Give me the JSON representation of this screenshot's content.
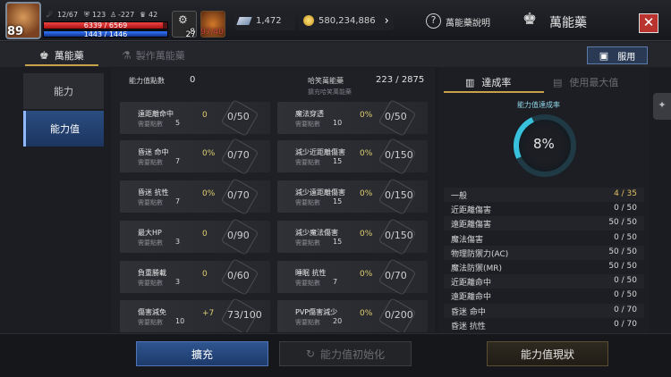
{
  "player": {
    "level": "89",
    "stat_a": "12/67",
    "stat_b": "123",
    "stat_c": "-227",
    "stat_d": "42",
    "hp_text": "6339 / 6569",
    "hp_fraction": 0.965,
    "mp_text": "1443 / 1446",
    "mp_fraction": 0.998,
    "buff1_count": "8",
    "buff2_count": "27",
    "buff3_count": "97/40"
  },
  "currency": {
    "gems": "1,472",
    "gold": "580,234,886"
  },
  "header": {
    "help_label": "萬能藥說明",
    "title": "萬能藥",
    "close_label": "✕"
  },
  "tabs": {
    "tab1": "萬能藥",
    "tab2": "製作萬能藥",
    "use_button": "服用"
  },
  "leftnav": {
    "item1": "能力",
    "item2": "能力值"
  },
  "center": {
    "points_label": "能力值點數",
    "points_value": "0",
    "grade_label": "哈笑萬能藥",
    "grade_value": "223 / 2875",
    "grade_sub": "擴充哈笑萬能藥",
    "required_label": "需要點數",
    "left_cells": [
      {
        "name": "遠距離命中",
        "req": "5",
        "pct": "0",
        "ratio": "0/50"
      },
      {
        "name": "昏迷 命中",
        "req": "7",
        "pct": "0%",
        "ratio": "0/70"
      },
      {
        "name": "昏迷 抗性",
        "req": "7",
        "pct": "0%",
        "ratio": "0/70"
      },
      {
        "name": "最大HP",
        "req": "3",
        "pct": "0",
        "ratio": "0/90"
      },
      {
        "name": "負重勝載",
        "req": "3",
        "pct": "0",
        "ratio": "0/60"
      },
      {
        "name": "傷害減免",
        "req": "10",
        "pct": "+7",
        "ratio": "73/100"
      }
    ],
    "right_cells": [
      {
        "name": "魔法穿透",
        "req": "10",
        "pct": "0%",
        "ratio": "0/50"
      },
      {
        "name": "減少近距離傷害",
        "req": "15",
        "pct": "0%",
        "ratio": "0/150"
      },
      {
        "name": "減少遠距離傷害",
        "req": "15",
        "pct": "0%",
        "ratio": "0/150"
      },
      {
        "name": "減少魔法傷害",
        "req": "15",
        "pct": "0%",
        "ratio": "0/150"
      },
      {
        "name": "睡眠 抗性",
        "req": "7",
        "pct": "0%",
        "ratio": "0/70"
      },
      {
        "name": "PVP傷害減少",
        "req": "20",
        "pct": "0%",
        "ratio": "0/200"
      }
    ]
  },
  "right": {
    "tab1": "達成率",
    "tab2": "使用最大值",
    "ring_label": "能力值達成率",
    "ring_value": "8%",
    "ring_fraction": 0.08,
    "rows": [
      {
        "name": "一般",
        "value": "4 / 35",
        "header": true
      },
      {
        "name": "近距離傷害",
        "value": "0 / 50"
      },
      {
        "name": "遠距離傷害",
        "value": "50 / 50"
      },
      {
        "name": "魔法傷害",
        "value": "0 / 50"
      },
      {
        "name": "物理防禦力(AC)",
        "value": "50 / 50"
      },
      {
        "name": "魔法防禦(MR)",
        "value": "50 / 50"
      },
      {
        "name": "近距離命中",
        "value": "0 / 50"
      },
      {
        "name": "遠距離命中",
        "value": "0 / 50"
      },
      {
        "name": "昏迷 命中",
        "value": "0 / 70"
      },
      {
        "name": "昏迷 抗性",
        "value": "0 / 70"
      }
    ]
  },
  "bottom": {
    "expand": "擴充",
    "reset": "能力值初始化",
    "status": "能力值現狀"
  }
}
